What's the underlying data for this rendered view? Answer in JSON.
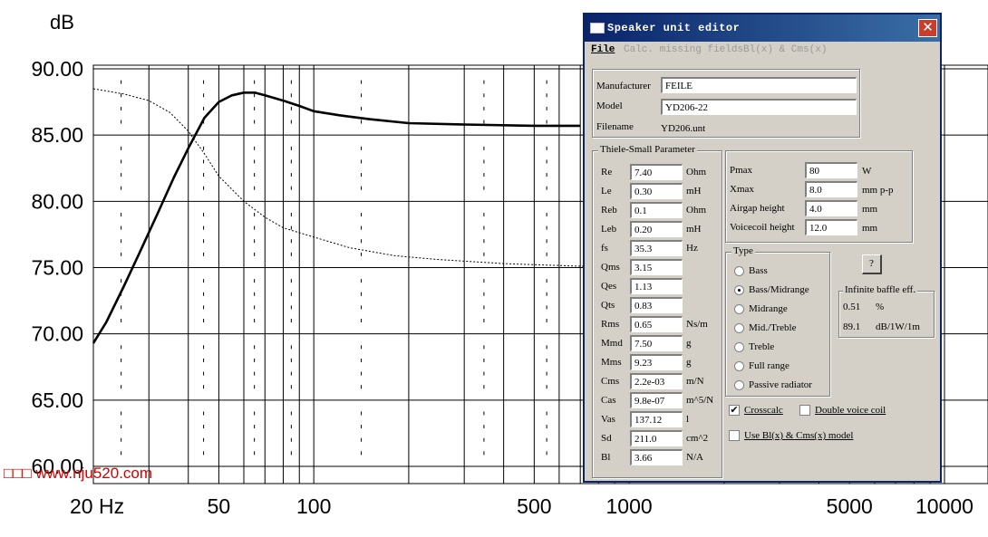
{
  "chart_data": {
    "type": "line",
    "ylabel": "dB",
    "ylim": [
      60,
      90
    ],
    "yticks": [
      "90.00",
      "85.00",
      "80.00",
      "75.00",
      "70.00",
      "65.00",
      "60.00"
    ],
    "x_scale": "log",
    "xlim": [
      20,
      10000
    ],
    "xticks": [
      {
        "value": 20,
        "label": "20 Hz"
      },
      {
        "value": 50,
        "label": "50"
      },
      {
        "value": 100,
        "label": "100"
      },
      {
        "value": 500,
        "label": "500"
      },
      {
        "value": 1000,
        "label": "1000"
      },
      {
        "value": 5000,
        "label": "5000"
      },
      {
        "value": 10000,
        "label": "10000"
      }
    ],
    "series": [
      {
        "style": "solid",
        "x": [
          20,
          22,
          25,
          28,
          32,
          36,
          40,
          45,
          50,
          55,
          60,
          65,
          70,
          80,
          90,
          100,
          120,
          150,
          200,
          300,
          500,
          700
        ],
        "y": [
          69.3,
          70.9,
          73.6,
          76.1,
          79.1,
          81.8,
          84.0,
          86.3,
          87.5,
          88.0,
          88.2,
          88.2,
          88.0,
          87.6,
          87.2,
          86.8,
          86.5,
          86.2,
          85.9,
          85.8,
          85.7,
          85.7
        ]
      },
      {
        "style": "dashed",
        "x": [
          20,
          25,
          30,
          35,
          40,
          45,
          50,
          60,
          70,
          80,
          100,
          130,
          180,
          250,
          400,
          700,
          1500,
          3000,
          6000,
          10000
        ],
        "y": [
          88.5,
          88.1,
          87.6,
          86.7,
          85.3,
          83.6,
          81.9,
          80.0,
          78.8,
          78.0,
          77.3,
          76.5,
          75.9,
          75.6,
          75.3,
          75.1,
          75.0,
          75.0,
          75.0,
          75.0
        ]
      }
    ]
  },
  "watermark": "□□□ www.nju520.com",
  "dialog": {
    "title": "Speaker unit editor",
    "close_glyph": "✕",
    "menu": {
      "file": "File",
      "calc": "Calc. missing fields",
      "bl": "Bl(x) & Cms(x)"
    },
    "info": {
      "manufacturer_label": "Manufacturer",
      "manufacturer": "FEILE",
      "model_label": "Model",
      "model": "YD206-22",
      "filename_label": "Filename",
      "filename": "YD206.unt"
    },
    "ts_title": "Thiele-Small Parameter",
    "params": [
      {
        "name": "Re",
        "value": "7.40",
        "unit": "Ohm"
      },
      {
        "name": "Le",
        "value": "0.30",
        "unit": "mH"
      },
      {
        "name": "Reb",
        "value": "0.1",
        "unit": "Ohm"
      },
      {
        "name": "Leb",
        "value": "0.20",
        "unit": "mH"
      },
      {
        "name": "fs",
        "value": "35.3",
        "unit": "Hz"
      },
      {
        "name": "Qms",
        "value": "3.15",
        "unit": ""
      },
      {
        "name": "Qes",
        "value": "1.13",
        "unit": ""
      },
      {
        "name": "Qts",
        "value": "0.83",
        "unit": ""
      },
      {
        "name": "Rms",
        "value": "0.65",
        "unit": "Ns/m"
      },
      {
        "name": "Mmd",
        "value": "7.50",
        "unit": "g"
      },
      {
        "name": "Mms",
        "value": "9.23",
        "unit": "g"
      },
      {
        "name": "Cms",
        "value": "2.2e-03",
        "unit": "m/N"
      },
      {
        "name": "Cas",
        "value": "9.8e-07",
        "unit": "m^5/N"
      },
      {
        "name": "Vas",
        "value": "137.12",
        "unit": "l"
      },
      {
        "name": "Sd",
        "value": "211.0",
        "unit": "cm^2"
      },
      {
        "name": "Bl",
        "value": "3.66",
        "unit": "N/A"
      }
    ],
    "power": [
      {
        "name": "Pmax",
        "value": "80",
        "unit": "W"
      },
      {
        "name": "Xmax",
        "value": "8.0",
        "unit": "mm p-p"
      },
      {
        "name": "Airgap height",
        "value": "4.0",
        "unit": "mm"
      },
      {
        "name": "Voicecoil height",
        "value": "12.0",
        "unit": "mm"
      }
    ],
    "type_title": "Type",
    "types": [
      {
        "label": "Bass",
        "selected": false
      },
      {
        "label": "Bass/Midrange",
        "selected": true
      },
      {
        "label": "Midrange",
        "selected": false
      },
      {
        "label": "Mid./Treble",
        "selected": false
      },
      {
        "label": "Treble",
        "selected": false
      },
      {
        "label": "Full range",
        "selected": false
      },
      {
        "label": "Passive radiator",
        "selected": false
      }
    ],
    "help_button": "?",
    "baffle": {
      "title": "Infinite baffle eff.",
      "eff": "0.51",
      "eff_unit": "%",
      "spl": "89.1",
      "spl_unit": "dB/1W/1m"
    },
    "options": {
      "crosscalc": {
        "label": "Crosscalc",
        "checked": true
      },
      "double_voice_coil": {
        "label": "Double voice coil",
        "checked": false
      },
      "use_bl_model": {
        "label": "Use Bl(x) & Cms(x) model",
        "checked": false
      }
    },
    "check_glyph": "✔"
  }
}
